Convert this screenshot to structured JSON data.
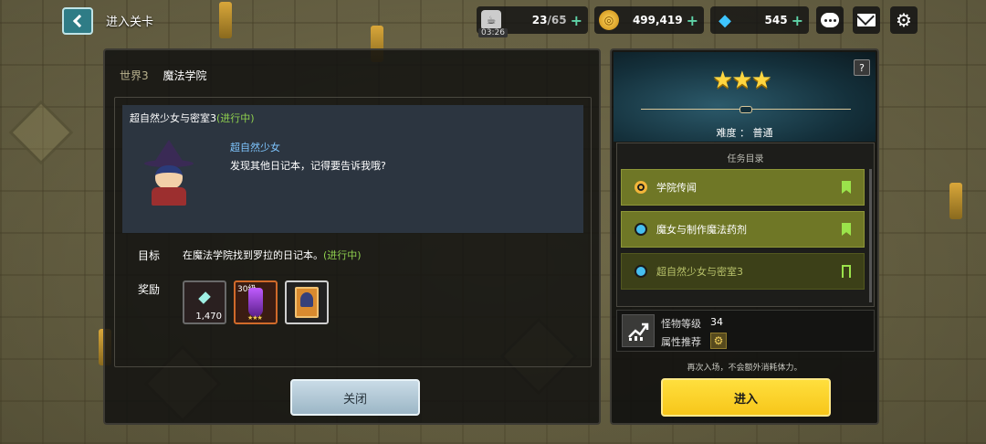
{
  "header": {
    "title": "进入关卡",
    "stamina": {
      "value": "23",
      "max": "/65",
      "timer": "03:26"
    },
    "gold": "499,419",
    "gems": "545",
    "plus": "+"
  },
  "stage": {
    "world": "世界3",
    "name": "魔法学院",
    "quest_title": "超自然少女与密室3",
    "quest_status": "(进行中)",
    "speaker": "超自然少女",
    "dialogue": "发现其他日记本，记得要告诉我哦?",
    "goal_label": "目标",
    "goal_text": "在魔法学院找到罗拉的日记本。",
    "goal_status": "(进行中)",
    "reward_label": "奖励",
    "rewards": [
      {
        "type": "crystal",
        "count": "1,470"
      },
      {
        "type": "weapon",
        "level": "30级",
        "stars": "★★★"
      },
      {
        "type": "card"
      }
    ],
    "close_label": "关闭"
  },
  "panel": {
    "help": "?",
    "stars": "★★★",
    "difficulty": "难度 ： 普通",
    "mission_header": "任务目录",
    "missions": [
      {
        "label": "学院传闻",
        "state": "current"
      },
      {
        "label": "魔女与制作魔法药剂",
        "state": "active"
      },
      {
        "label": "超自然少女与密室3",
        "state": "in-progress"
      }
    ],
    "monster_level_label": "怪物等级",
    "monster_level": "34",
    "attribute_label": "属性推荐",
    "note": "再次入场，不会额外消耗体力。",
    "enter_label": "进入"
  },
  "colors": {
    "accent_yellow": "#f7c61a",
    "progress_green": "#8fd04e",
    "mission_green": "#6f7726",
    "speaker_blue": "#7fc6ff"
  }
}
